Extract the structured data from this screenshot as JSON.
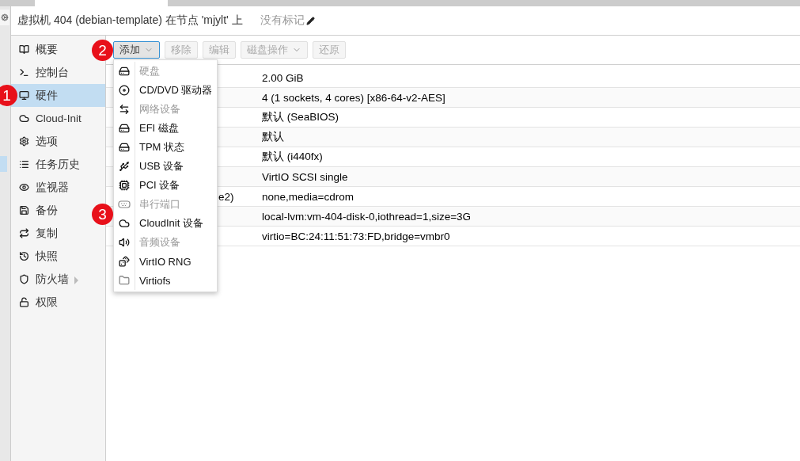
{
  "header": {
    "title": "虚拟机 404 (debian-template) 在节点 'mjylt' 上",
    "tags": "没有标记"
  },
  "nav": [
    {
      "label": "概要",
      "selected": false
    },
    {
      "label": "控制台",
      "selected": false
    },
    {
      "label": "硬件",
      "selected": true
    },
    {
      "label": "Cloud-Init",
      "selected": false
    },
    {
      "label": "选项",
      "selected": false
    },
    {
      "label": "任务历史",
      "selected": false
    },
    {
      "label": "监视器",
      "selected": false
    },
    {
      "label": "备份",
      "selected": false
    },
    {
      "label": "复制",
      "selected": false
    },
    {
      "label": "快照",
      "selected": false
    },
    {
      "label": "防火墙",
      "selected": false,
      "expandable": true
    },
    {
      "label": "权限",
      "selected": false
    }
  ],
  "toolbar": [
    {
      "label": "添加",
      "disabled": false,
      "dropdown": true
    },
    {
      "label": "移除",
      "disabled": true,
      "dropdown": false
    },
    {
      "label": "编辑",
      "disabled": true,
      "dropdown": false
    },
    {
      "label": "磁盘操作",
      "disabled": true,
      "dropdown": true
    },
    {
      "label": "还原",
      "disabled": true,
      "dropdown": false
    }
  ],
  "add_menu": [
    {
      "label": "硬盘",
      "disabled": true
    },
    {
      "label": "CD/DVD 驱动器",
      "disabled": false
    },
    {
      "label": "网络设备",
      "disabled": true
    },
    {
      "label": "EFI 磁盘",
      "disabled": false
    },
    {
      "label": "TPM 状态",
      "disabled": false
    },
    {
      "label": "USB 设备",
      "disabled": false
    },
    {
      "label": "PCI 设备",
      "disabled": false
    },
    {
      "label": "串行端口",
      "disabled": true
    },
    {
      "label": "CloudInit 设备",
      "disabled": false
    },
    {
      "label": "音频设备",
      "disabled": true
    },
    {
      "label": "VirtIO RNG",
      "disabled": false
    },
    {
      "label": "Virtiofs",
      "disabled": false
    }
  ],
  "table": {
    "rows": [
      {
        "value": "2.00 GiB"
      },
      {
        "value": "4 (1 sockets, 4 cores) [x86-64-v2-AES]"
      },
      {
        "value": "默认 (SeaBIOS)"
      },
      {
        "value": "默认"
      },
      {
        "value": "默认 (i440fx)"
      },
      {
        "value": "VirtIO SCSI single"
      },
      {
        "column_1": "e2)",
        "value": "none,media=cdrom"
      },
      {
        "value": "local-lvm:vm-404-disk-0,iothread=1,size=3G"
      },
      {
        "value": "virtio=BC:24:11:51:73:FD,bridge=vmbr0"
      }
    ]
  },
  "callouts": [
    "1",
    "2",
    "3"
  ]
}
